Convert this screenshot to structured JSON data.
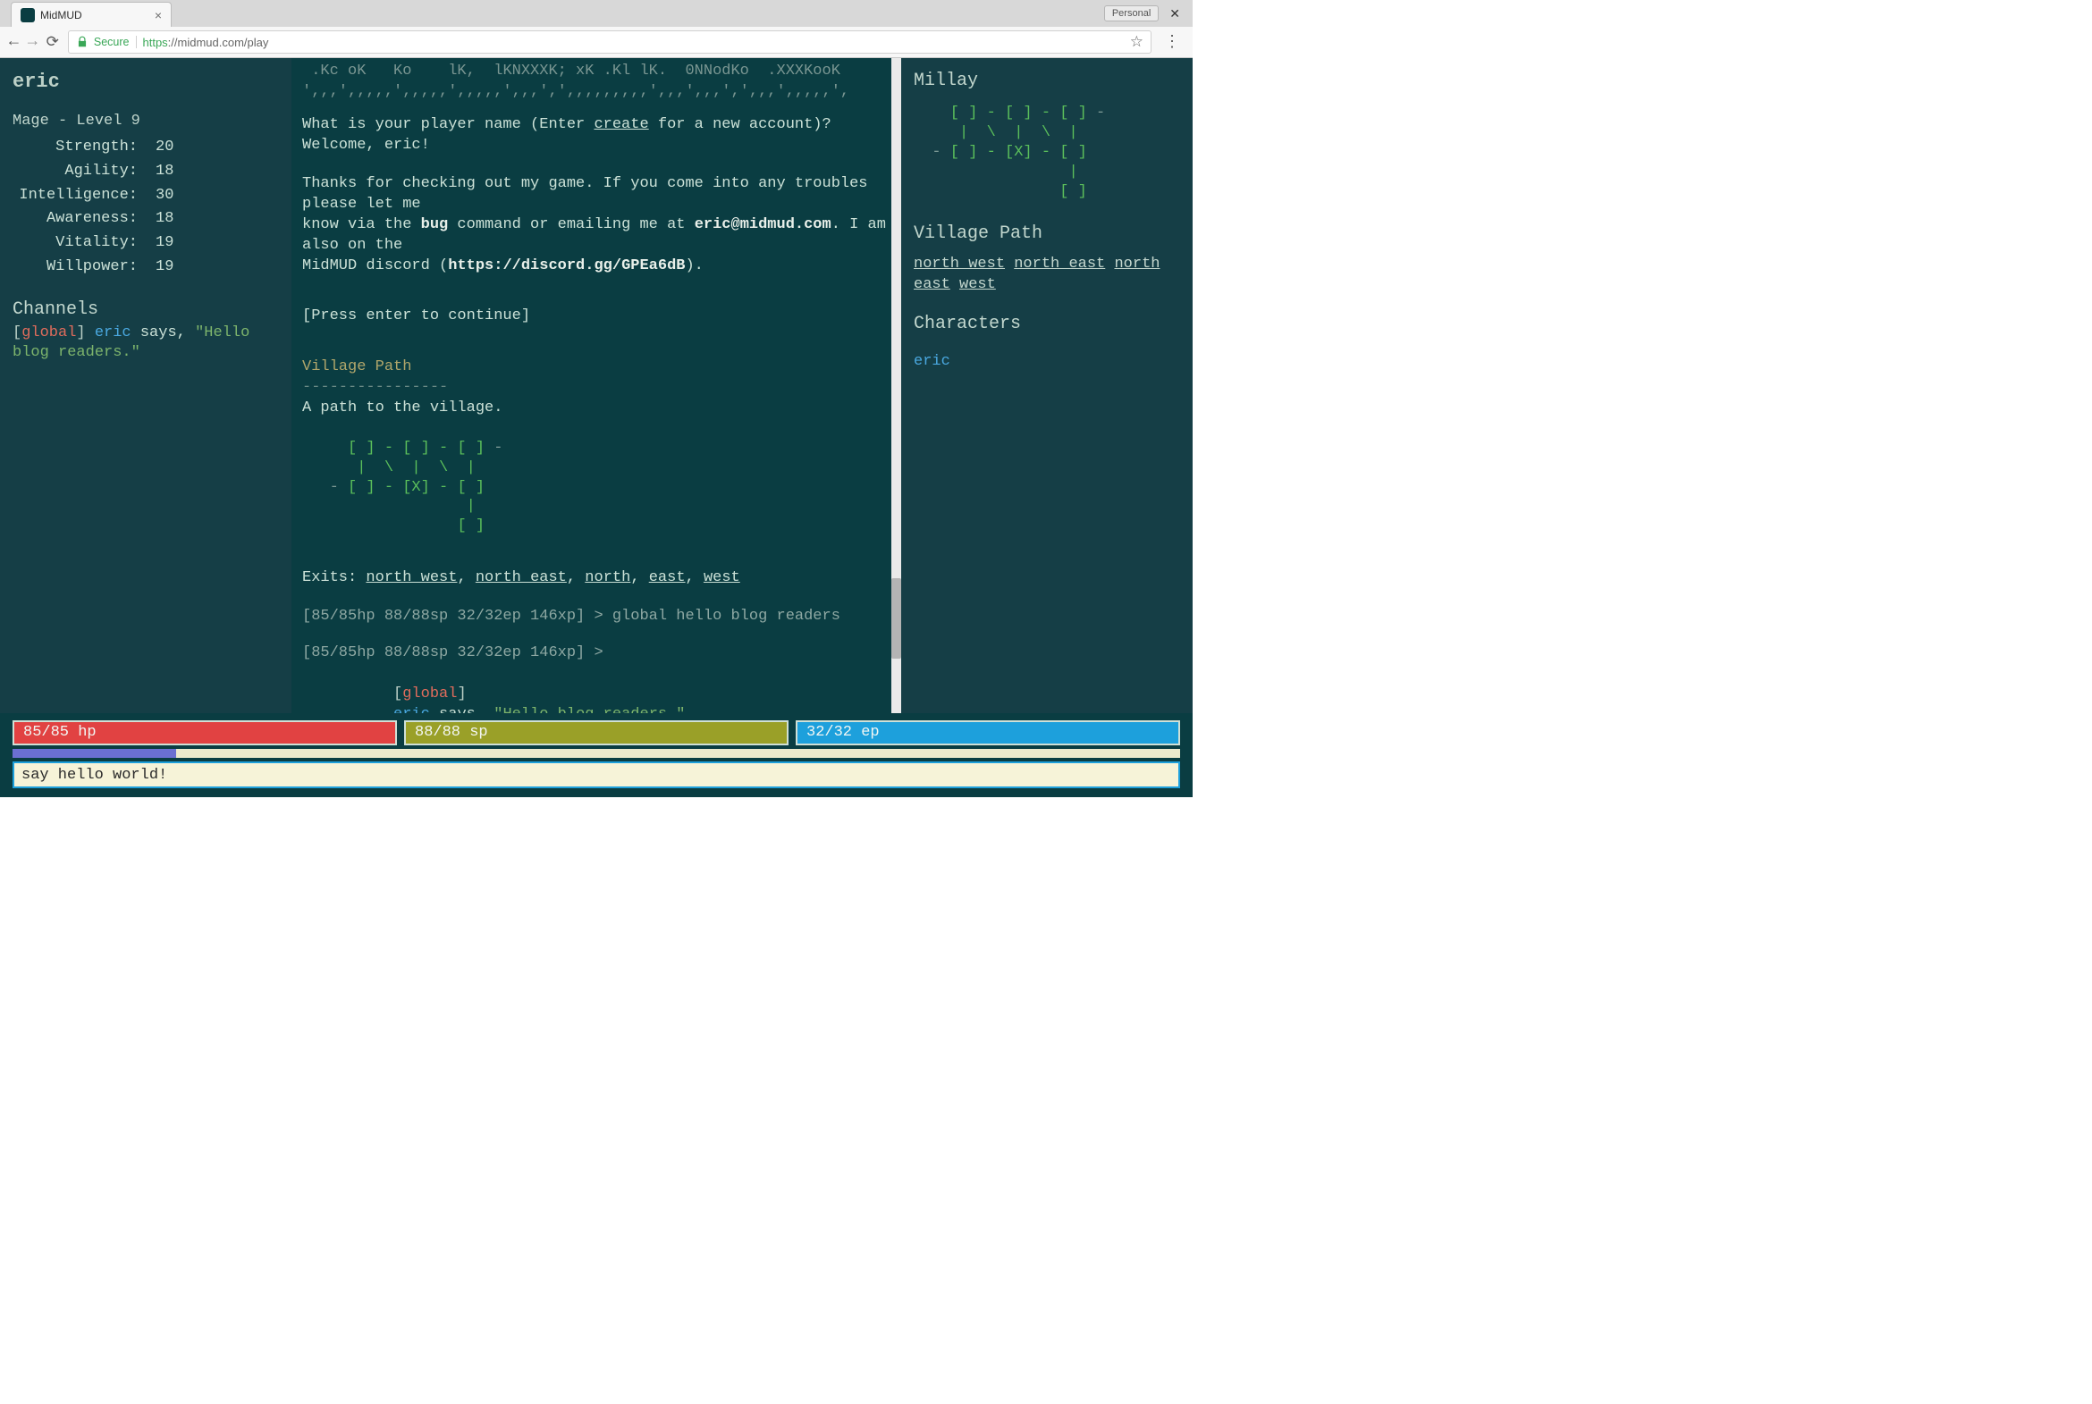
{
  "chrome": {
    "tab_title": "MidMUD",
    "personal_badge": "Personal",
    "secure_label": "Secure",
    "url_scheme": "https",
    "url_rest": "://midmud.com/play"
  },
  "player": {
    "name": "eric",
    "class_line": "Mage - Level 9",
    "stats": {
      "Strength": "20",
      "Agility": "18",
      "Intelligence": "30",
      "Awareness": "18",
      "Vitality": "19",
      "Willpower": "19"
    }
  },
  "channels": {
    "header": "Channels",
    "line": {
      "bracket_open": "[",
      "channel": "global",
      "bracket_close": "]",
      "speaker": "eric",
      "middle": " says, ",
      "text": "\"Hello blog readers.\""
    }
  },
  "log": {
    "cut_top_line1": " .Kc oK   Ko    lK,  lKNXXXK; xK .Kl lK.  0NNodKo  .XXXKooK ",
    "cut_top_line2": "',,,',,,,,',,,,,',,,,,',,,',',,,,,,,,,',,,',,,',',,,',,,,,',",
    "prompt_q_pre": "What is your player name (Enter ",
    "prompt_q_create": "create",
    "prompt_q_post": " for a new account)?",
    "welcome": "Welcome, eric!",
    "thanks1": "Thanks for checking out my game. If you come into any troubles please let me",
    "thanks2_pre": "know via the ",
    "thanks2_bug": "bug",
    "thanks2_mid": " command or emailing me at ",
    "thanks2_email": "eric@midmud.com",
    "thanks2_post": ". I am also on the",
    "thanks3_pre": "MidMUD discord (",
    "thanks3_link": "https://discord.gg/GPEa6dB",
    "thanks3_post": ").",
    "press_enter": "[Press enter to continue]",
    "room_title": "Village Path",
    "room_dash": "----------------",
    "room_desc": "A path to the village.",
    "map_l1_a": "     [ ] - [ ] - [ ] ",
    "map_l1_b": "-",
    "map_l2": "      |  \\  |  \\  |  ",
    "map_l3_a": "   -",
    "map_l3_b": " [ ] - [X] - ",
    "map_l3_c": "[ ]",
    "map_l4_ws": "                  ",
    "map_l4_c": "|",
    "map_l5_ws": "                 ",
    "map_l5_c": "[ ]",
    "exits_label": "Exits: ",
    "exits": [
      "north west",
      "north east",
      "north",
      "east",
      "west"
    ],
    "prompt_prefix": "[85/85hp 88/88sp 32/32ep 146xp] > ",
    "cmd1": "global hello blog readers",
    "chan_echo": {
      "bracket_open": "[",
      "channel": "global",
      "bracket_close": "]",
      "speaker": "eric",
      "middle": " says, ",
      "text": "\"Hello blog readers.\""
    }
  },
  "right": {
    "region": "Millay",
    "map_l1_a": "    [ ] - [ ] - [ ] ",
    "map_l1_b": "-",
    "map_l2": "     |  \\  |  \\  |  ",
    "map_l3_a": "  -",
    "map_l3_b": " [ ] - [X] - ",
    "map_l3_c": "[ ]",
    "map_l4_ws": "                 ",
    "map_l4_c": "|",
    "map_l5_ws": "                ",
    "map_l5_c": "[ ]",
    "room_title": "Village Path",
    "exits": [
      "north west",
      "north east",
      "north",
      "east",
      "west"
    ],
    "characters_hdr": "Characters",
    "characters": [
      "eric"
    ]
  },
  "bars": {
    "hp": "85/85 hp",
    "sp": "88/88 sp",
    "ep": "32/32 ep",
    "xp_percent": 14
  },
  "command_input": "say hello world!"
}
